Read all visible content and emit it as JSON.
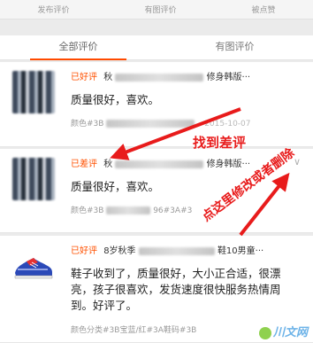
{
  "topbar": {
    "items": [
      "发布评价",
      "有图评价",
      "被点赞"
    ]
  },
  "tabs": [
    {
      "label": "全部评价",
      "active": true
    },
    {
      "label": "有图评价",
      "active": false
    }
  ],
  "reviews": [
    {
      "rating": "已好评",
      "title_prefix": "秋",
      "title_suffix": "修身韩版···",
      "content": "质量很好，喜欢。",
      "sku_prefix": "颜色#3B",
      "date": "2015-10-07"
    },
    {
      "rating": "已差评",
      "title_prefix": "秋",
      "title_suffix": "修身韩版···",
      "content": "质量很好，喜欢。",
      "sku_prefix": "颜色#3B",
      "sku_mid": "96#3A#3",
      "has_chevron": true
    },
    {
      "rating": "已好评",
      "title_prefix": "8岁秋季",
      "title_suffix": "鞋10男童···",
      "content": "鞋子收到了，质量很好，大小正合适，很漂亮，孩子很喜欢，发货速度很快服务热情周到。好评了。",
      "sku": "颜色分类#3B宝蓝/红#3A鞋码#3B"
    }
  ],
  "annotations": {
    "find_bad_review": "找到差评",
    "click_to_edit": "点这里修改或者删除",
    "color": "#e81b1b"
  },
  "watermark": {
    "text": "川文网"
  },
  "colors": {
    "accent": "#ff5000",
    "tab_indicator": "#ff4a00"
  }
}
